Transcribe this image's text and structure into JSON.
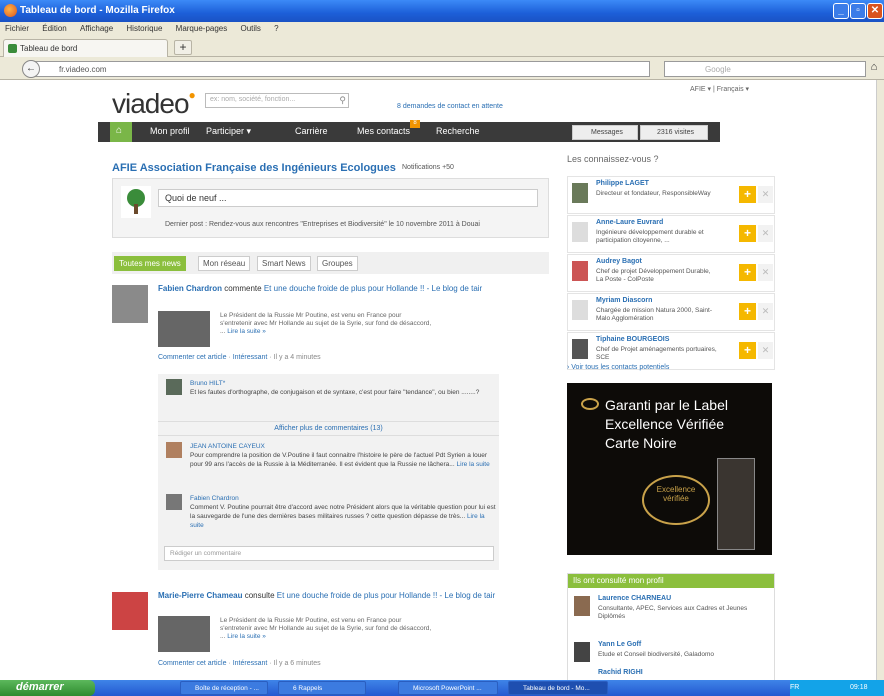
{
  "window": {
    "title": "Tableau de bord - Mozilla Firefox",
    "controls": {
      "minimize": "_",
      "maximize": "▫",
      "close": "✕"
    }
  },
  "menu": [
    "Fichier",
    "Édition",
    "Affichage",
    "Historique",
    "Marque-pages",
    "Outils",
    "?"
  ],
  "tab": {
    "label": "Tableau de bord",
    "new_tab": "+"
  },
  "nav": {
    "url": "fr.viadeo.com",
    "search_placeholder": "Google",
    "back": "←",
    "home": "⌂"
  },
  "site": {
    "logo": "viadeo",
    "search_placeholder": "ex: nom, société, fonction...",
    "pending": "8 demandes de contact en attente",
    "lang": "AFIE ▾   |   Français ▾",
    "nav": {
      "home": "⌂",
      "profile": "Mon profil",
      "participate": "Participer ▾",
      "career": "Carrière",
      "contacts": "Mes contacts",
      "contacts_badge": "8",
      "search": "Recherche",
      "messages": "Messages",
      "visits": "2316 visites"
    }
  },
  "org": {
    "name": "AFIE Association Française des Ingénieurs Ecologues",
    "notifications": "Notifications +50",
    "whatsnew": "Quoi de neuf ...",
    "lastpost": "Dernier post : Rendez-vous aux rencontres \"Entreprises et Biodiversité\" le 10 novembre 2011 à Douai"
  },
  "feed_tabs": [
    "Toutes mes news",
    "Mon réseau",
    "Smart News",
    "Groupes"
  ],
  "posts": [
    {
      "author": "Fabien Chardron",
      "verb": "commente",
      "link": "Et une douche froide de plus pour Hollande !! - Le blog de tair",
      "excerpt": "Le Président de la Russie Mr Poutine, est venu en France pour s'entretenir avec Mr Hollande au sujet de la Syrie, sur fond de désaccord, ...",
      "read_more": "Lire la suite »",
      "comment_link": "Commenter cet article",
      "interesting": "Intéressant",
      "time": "· Il y a 4 minutes"
    },
    {
      "author": "Marie-Pierre Chameau",
      "verb": "consulte",
      "link": "Et une douche froide de plus pour Hollande !! - Le blog de tair",
      "excerpt": "Le Président de la Russie Mr Poutine, est venu en France pour s'entretenir avec Mr Hollande au sujet de la Syrie, sur fond de désaccord, ...",
      "read_more": "Lire la suite »",
      "comment_link": "Commenter cet article",
      "interesting": "Intéressant",
      "time": "· Il y a 6 minutes"
    }
  ],
  "comments": [
    {
      "who": "Bruno HILT*",
      "text": "Et les fautes d'orthographe, de conjugaison et de syntaxe, c'est pour faire \"tendance\", ou bien ........?"
    },
    {
      "who": "JEAN ANTOINE CAYEUX",
      "text": "Pour comprendre la position de V.Poutine il faut connaitre l'histoire le père de l'actuel Pdt Syrien a louer pour 99 ans l'accès de la Russie à la Méditerranée. Il est évident que la Russie ne lâchera...",
      "more": "Lire la suite"
    },
    {
      "who": "Fabien Chardron",
      "text": "Comment V. Poutine pourrait être d'accord avec notre Président alors que la véritable question pour lui est la sauvegarde de l'une des dernières bases militaires russes ? cette question dépasse de très...",
      "more": "Lire la suite"
    }
  ],
  "more_comments": "Afficher plus de commentaires (13)",
  "comment_placeholder": "Rédiger un commentaire",
  "sidebar": {
    "pymk_title": "Les connaissez-vous ?",
    "people": [
      {
        "name": "Philippe LAGET",
        "desc": "Directeur et fondateur, ResponsibleWay"
      },
      {
        "name": "Anne-Laure Euvrard",
        "desc": "Ingénieure développement durable et participation citoyenne, ..."
      },
      {
        "name": "Audrey Bagot",
        "desc": "Chef de projet Développement Durable, La Poste - ColPoste"
      },
      {
        "name": "Myriam Diascorn",
        "desc": "Chargée de mission Natura 2000, Saint-Malo Agglomération"
      },
      {
        "name": "Tiphaine BOURGEOIS",
        "desc": "Chef de Projet aménagements portuaires, SCE"
      }
    ],
    "add": "+",
    "dismiss": "✕",
    "all_contacts": "› Voir tous les contacts potentiels",
    "ad": {
      "line1": "Garanti par le Label",
      "line2": "Excellence Vérifiée",
      "line3": "Carte Noire",
      "badge": "Excellence vérifiée"
    },
    "consulted_title": "Ils ont consulté mon profil",
    "viewers": [
      {
        "name": "Laurence CHARNEAU",
        "desc": "Consultante, APEC, Services aux Cadres et Jeunes Diplômés"
      },
      {
        "name": "Yann Le Goff",
        "desc": "Etude et Conseil biodiversité, Galadomo"
      },
      {
        "name": "Rachid RIGHI",
        "desc": ""
      }
    ]
  },
  "taskbar": {
    "start": "démarrer",
    "tasks": [
      "Boîte de réception - ...",
      "6 Rappels",
      "Microsoft PowerPoint ...",
      "Tableau de bord - Mo..."
    ],
    "lang": "FR",
    "clock": "09:18"
  }
}
